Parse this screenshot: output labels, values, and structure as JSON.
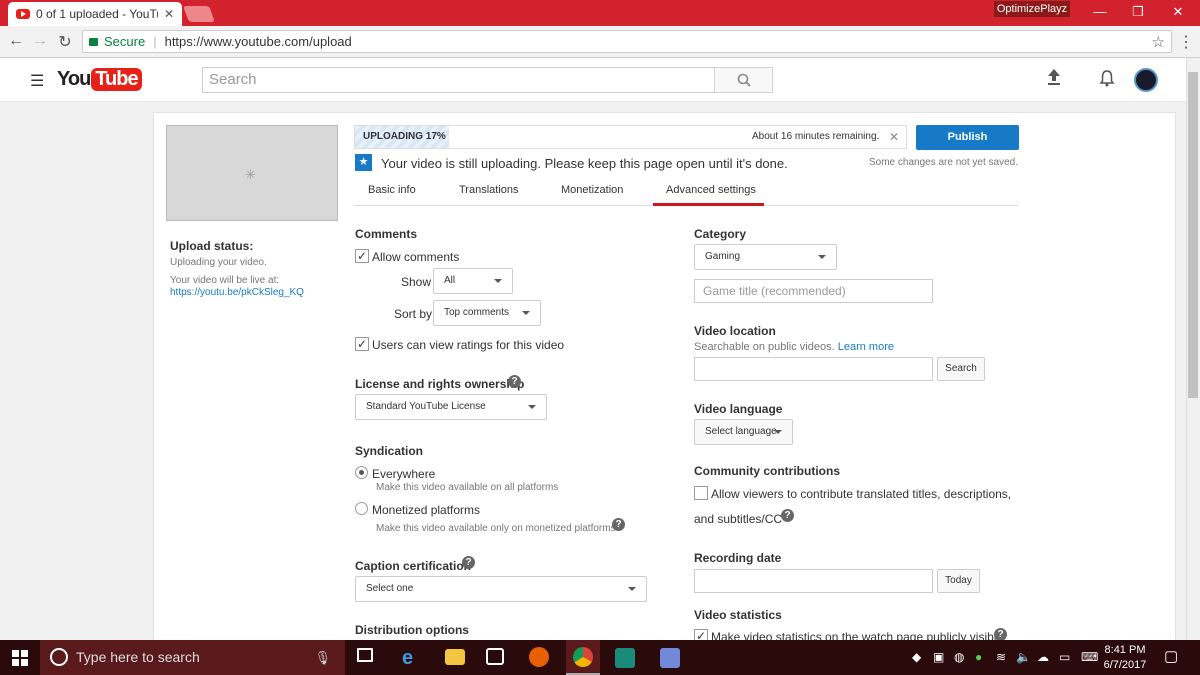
{
  "browser": {
    "tab_title": "0 of 1 uploaded - YouTu",
    "profile_name": "OptimizePlayz",
    "secure_label": "Secure",
    "url": "https://www.youtube.com/upload"
  },
  "header": {
    "logo_you": "You",
    "logo_tube": "Tube",
    "search_placeholder": "Search"
  },
  "upload": {
    "status_title": "Upload status:",
    "status_line": "Uploading your video.",
    "live_label": "Your video will be live at:",
    "live_url": "https://youtu.be/pkCkSleg_KQ",
    "progress_label": "UPLOADING 17%",
    "progress_fraction": 0.17,
    "remaining": "About 16 minutes remaining.",
    "publish_label": "Publish",
    "still_uploading": "Your video is still uploading. Please keep this page open until it's done.",
    "not_saved": "Some changes are not yet saved."
  },
  "tabs": [
    "Basic info",
    "Translations",
    "Monetization",
    "Advanced settings"
  ],
  "active_tab": "Advanced settings",
  "left": {
    "comments_heading": "Comments",
    "allow_comments": "Allow comments",
    "allow_comments_checked": true,
    "show_label": "Show",
    "show_value": "All",
    "sort_label": "Sort by",
    "sort_value": "Top comments",
    "ratings_label": "Users can view ratings for this video",
    "ratings_checked": true,
    "license_heading": "License and rights ownership",
    "license_value": "Standard YouTube License",
    "syndication_heading": "Syndication",
    "everywhere_label": "Everywhere",
    "everywhere_desc": "Make this video available on all platforms",
    "monetized_label": "Monetized platforms",
    "monetized_desc": "Make this video available only on monetized platforms",
    "caption_heading": "Caption certification",
    "caption_value": "Select one",
    "distribution_heading": "Distribution options"
  },
  "right": {
    "category_heading": "Category",
    "category_value": "Gaming",
    "game_title_placeholder": "Game title (recommended)",
    "location_heading": "Video location",
    "location_desc": "Searchable on public videos.",
    "learn_more": "Learn more",
    "location_search": "Search",
    "language_heading": "Video language",
    "language_value": "Select language",
    "community_heading": "Community contributions",
    "community_label_1": "Allow viewers to contribute translated titles, descriptions,",
    "community_label_2": "and subtitles/CC",
    "recording_heading": "Recording date",
    "today_label": "Today",
    "stats_heading": "Video statistics",
    "stats_label": "Make video statistics on the watch page publicly visible"
  },
  "taskbar": {
    "search_placeholder": "Type here to search",
    "time": "8:41 PM",
    "date": "6/7/2017"
  },
  "colors": {
    "chrome_red": "#d2222d",
    "publish_blue": "#167ac6",
    "tab_underline": "#cc181e",
    "taskbar": "#2b0a0c"
  }
}
